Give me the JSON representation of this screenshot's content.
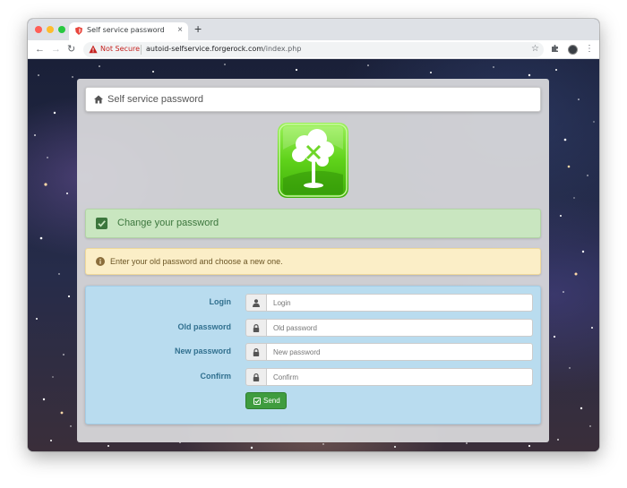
{
  "browser": {
    "tab_title": "Self service password",
    "tab_close": "×",
    "new_tab": "+",
    "security_label": "Not Secure",
    "url_host": "autoid-selfservice.forgerock.com",
    "url_path": "/index.php",
    "icons": [
      "back-icon",
      "forward-icon",
      "reload-icon",
      "warning-icon",
      "star-icon",
      "extensions-icon",
      "profile-icon",
      "menu-icon"
    ]
  },
  "page": {
    "header_title": "Self service password",
    "success_message": "Change your password",
    "info_message": "Enter your old password and choose a new one.",
    "form": {
      "fields": [
        {
          "label": "Login",
          "placeholder": "Login",
          "icon": "user-icon"
        },
        {
          "label": "Old password",
          "placeholder": "Old password",
          "icon": "lock-icon"
        },
        {
          "label": "New password",
          "placeholder": "New password",
          "icon": "lock-icon"
        },
        {
          "label": "Confirm",
          "placeholder": "Confirm",
          "icon": "lock-icon"
        }
      ],
      "submit_label": "Send"
    },
    "colors": {
      "success_bg": "#c9e6c0",
      "warning_bg": "#fbeec7",
      "form_bg": "#b9dcef",
      "button": "#3f9c3f",
      "label": "#31708f"
    }
  }
}
